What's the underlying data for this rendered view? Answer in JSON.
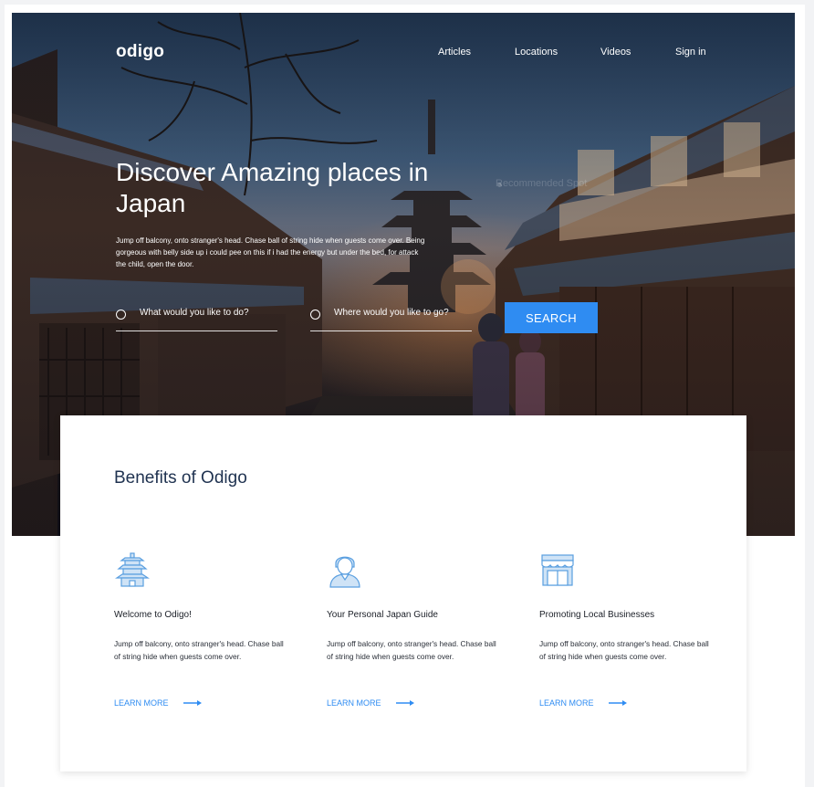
{
  "brand": {
    "logo": "odigo"
  },
  "nav": {
    "items": [
      "Articles",
      "Locations",
      "Videos",
      "Sign in"
    ]
  },
  "hero": {
    "headline": "Discover Amazing places in Japan",
    "subtext": "Jump off balcony, onto stranger's head. Chase ball of string hide when guests come over. Being gorgeous with belly side up i could pee on this if i had the energy but under the bed, for attack the child, open the door.",
    "background_tag": "Recommended Spot"
  },
  "search": {
    "what_placeholder": "What would you like to do?",
    "where_placeholder": "Where would you like to go?",
    "button_label": "SEARCH"
  },
  "benefits": {
    "title": "Benefits of Odigo",
    "items": [
      {
        "icon": "pagoda-icon",
        "title": "Welcome to Odigo!",
        "body": "Jump off balcony, onto stranger's head. Chase ball of string hide when guests come over.",
        "link": "LEARN MORE"
      },
      {
        "icon": "guide-person-icon",
        "title": "Your Personal Japan Guide",
        "body": "Jump off balcony, onto stranger's head. Chase ball of string hide when guests come over.",
        "link": "LEARN MORE"
      },
      {
        "icon": "storefront-icon",
        "title": "Promoting Local Businesses",
        "body": "Jump off balcony, onto stranger's head. Chase ball of string hide when guests come over.",
        "link": "LEARN MORE"
      }
    ]
  },
  "colors": {
    "accent": "#2f8cf2",
    "heading": "#1f3250",
    "icon_stroke": "#5a9fe0",
    "icon_fill": "#cfe3f6"
  }
}
